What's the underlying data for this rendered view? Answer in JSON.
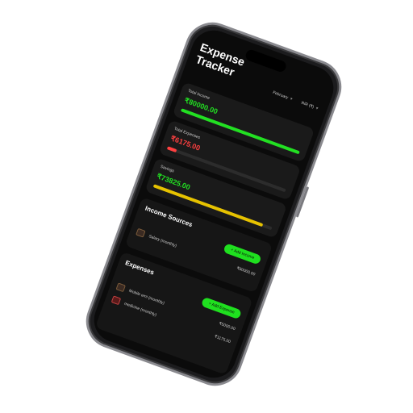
{
  "app": {
    "title": "Expense Tracker"
  },
  "header": {
    "month_select": "February",
    "currency_select": "INR (₹)"
  },
  "summary": {
    "income": {
      "label": "Total Income",
      "amount": "₹80000.00",
      "progress": 1.0,
      "color": "#22e022"
    },
    "expenses": {
      "label": "Total Expenses",
      "amount": "₹6175.00",
      "progress": 0.08,
      "color": "#ff4040"
    },
    "savings": {
      "label": "Savings",
      "amount": "₹73825.00",
      "progress": 0.92,
      "color": "#e6c200"
    }
  },
  "income_sources": {
    "title": "Income Sources",
    "add_label": "+ Add Income",
    "items": [
      {
        "label": "Salary (monthly)",
        "amount": "₹80000.00"
      }
    ]
  },
  "expenses": {
    "title": "Expenses",
    "add_label": "+ Add Expense",
    "items": [
      {
        "label": "Mobile emi (monthly)",
        "amount": "₹5000.00"
      },
      {
        "label": "medicine (monthly)",
        "amount": "₹1175.00"
      }
    ]
  },
  "colors": {
    "accent_green": "#1fe01f",
    "expense_red": "#ff4040",
    "savings_yellow": "#e6c200",
    "background": "#0b0b0b"
  }
}
